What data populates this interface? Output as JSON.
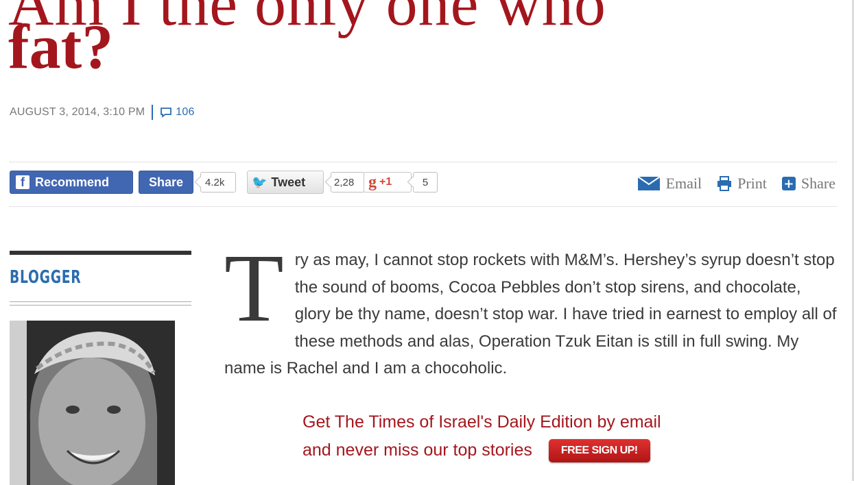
{
  "article": {
    "title": "fat?",
    "date": "AUGUST 3, 2014, 3:10 PM",
    "comment_count": "106",
    "dropcap": "T",
    "body": "ry as may, I cannot stop rockets with M&M’s. Hershey’s syrup doesn’t stop the sound of booms, Cocoa Pebbles don’t stop sirens, and chocolate, glory be thy name, doesn’t stop war. I have tried in earnest to employ all of these methods and alas, Operation Tzuk Eitan is still in full swing. My name is Rachel and I am a chocoholic."
  },
  "share_bar": {
    "fb_recommend": "Recommend",
    "fb_share": "Share",
    "fb_count": "4.2k",
    "tweet": "Tweet",
    "tweet_count": "2,28",
    "gplus": "+1",
    "gplus_count": "5",
    "email": "Email",
    "print": "Print",
    "share": "Share"
  },
  "sidebar": {
    "heading": "BLOGGER"
  },
  "promo": {
    "line1": "Get The Times of Israel's Daily Edition by email",
    "line2": "and never miss our top stories",
    "button": "FREE SIGN UP!"
  },
  "colors": {
    "accent_red": "#a4161d",
    "link_blue": "#2b6cb0",
    "facebook": "#4267b2"
  },
  "icons": [
    "comment-icon",
    "facebook-icon",
    "twitter-icon",
    "gplus-icon",
    "email-icon",
    "print-icon",
    "share-plus-icon"
  ]
}
